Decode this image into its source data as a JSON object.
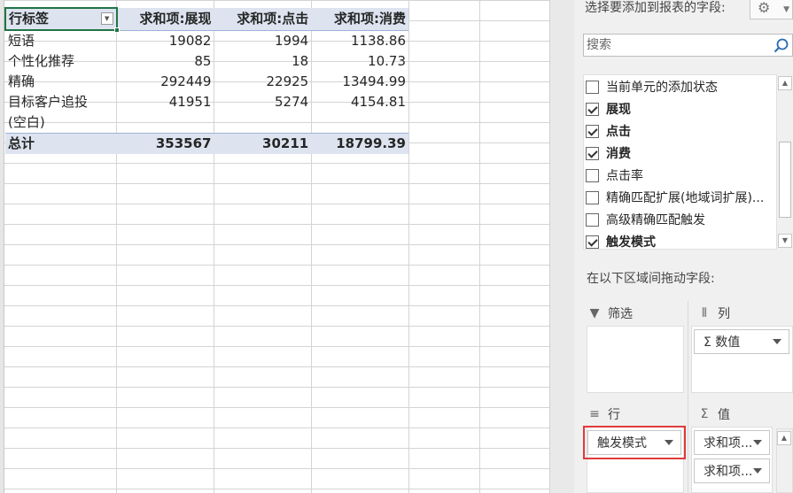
{
  "pivot": {
    "headers": [
      "行标签",
      "求和项:展现",
      "求和项:点击",
      "求和项:消费"
    ],
    "rows": [
      [
        "短语",
        "19082",
        "1994",
        "1138.86"
      ],
      [
        "个性化推荐",
        "85",
        "18",
        "10.73"
      ],
      [
        "精确",
        "292449",
        "22925",
        "13494.99"
      ],
      [
        "目标客户追投",
        "41951",
        "5274",
        "4154.81"
      ],
      [
        "(空白)",
        "",
        "",
        ""
      ]
    ],
    "total": [
      "总计",
      "353567",
      "30211",
      "18799.39"
    ]
  },
  "field_pane": {
    "title": "选择要添加到报表的字段:",
    "settings_icon": "gear-icon",
    "search_placeholder": "搜索",
    "fields": [
      {
        "label": "当前单元的添加状态",
        "checked": false,
        "bold": false
      },
      {
        "label": "展现",
        "checked": true,
        "bold": true
      },
      {
        "label": "点击",
        "checked": true,
        "bold": true
      },
      {
        "label": "消费",
        "checked": true,
        "bold": true
      },
      {
        "label": "点击率",
        "checked": false,
        "bold": false
      },
      {
        "label": "精确匹配扩展(地域词扩展)...",
        "checked": false,
        "bold": false
      },
      {
        "label": "高级精确匹配触发",
        "checked": false,
        "bold": false
      },
      {
        "label": "触发模式",
        "checked": true,
        "bold": true
      }
    ],
    "drag_hint": "在以下区域间拖动字段:",
    "areas": {
      "filter": {
        "title": "筛选",
        "icon": "filter-icon"
      },
      "columns": {
        "title": "列",
        "icon": "columns-icon",
        "items": [
          "Σ 数值"
        ]
      },
      "rows": {
        "title": "行",
        "icon": "rows-icon",
        "items": [
          "触发模式"
        ]
      },
      "values": {
        "title": "值",
        "icon": "sigma-icon",
        "items": [
          "求和项...",
          "求和项..."
        ]
      }
    }
  },
  "colors": {
    "pivot_header_bg": "#dde4f0",
    "selection": "#217346",
    "highlight": "#e03a3a"
  }
}
